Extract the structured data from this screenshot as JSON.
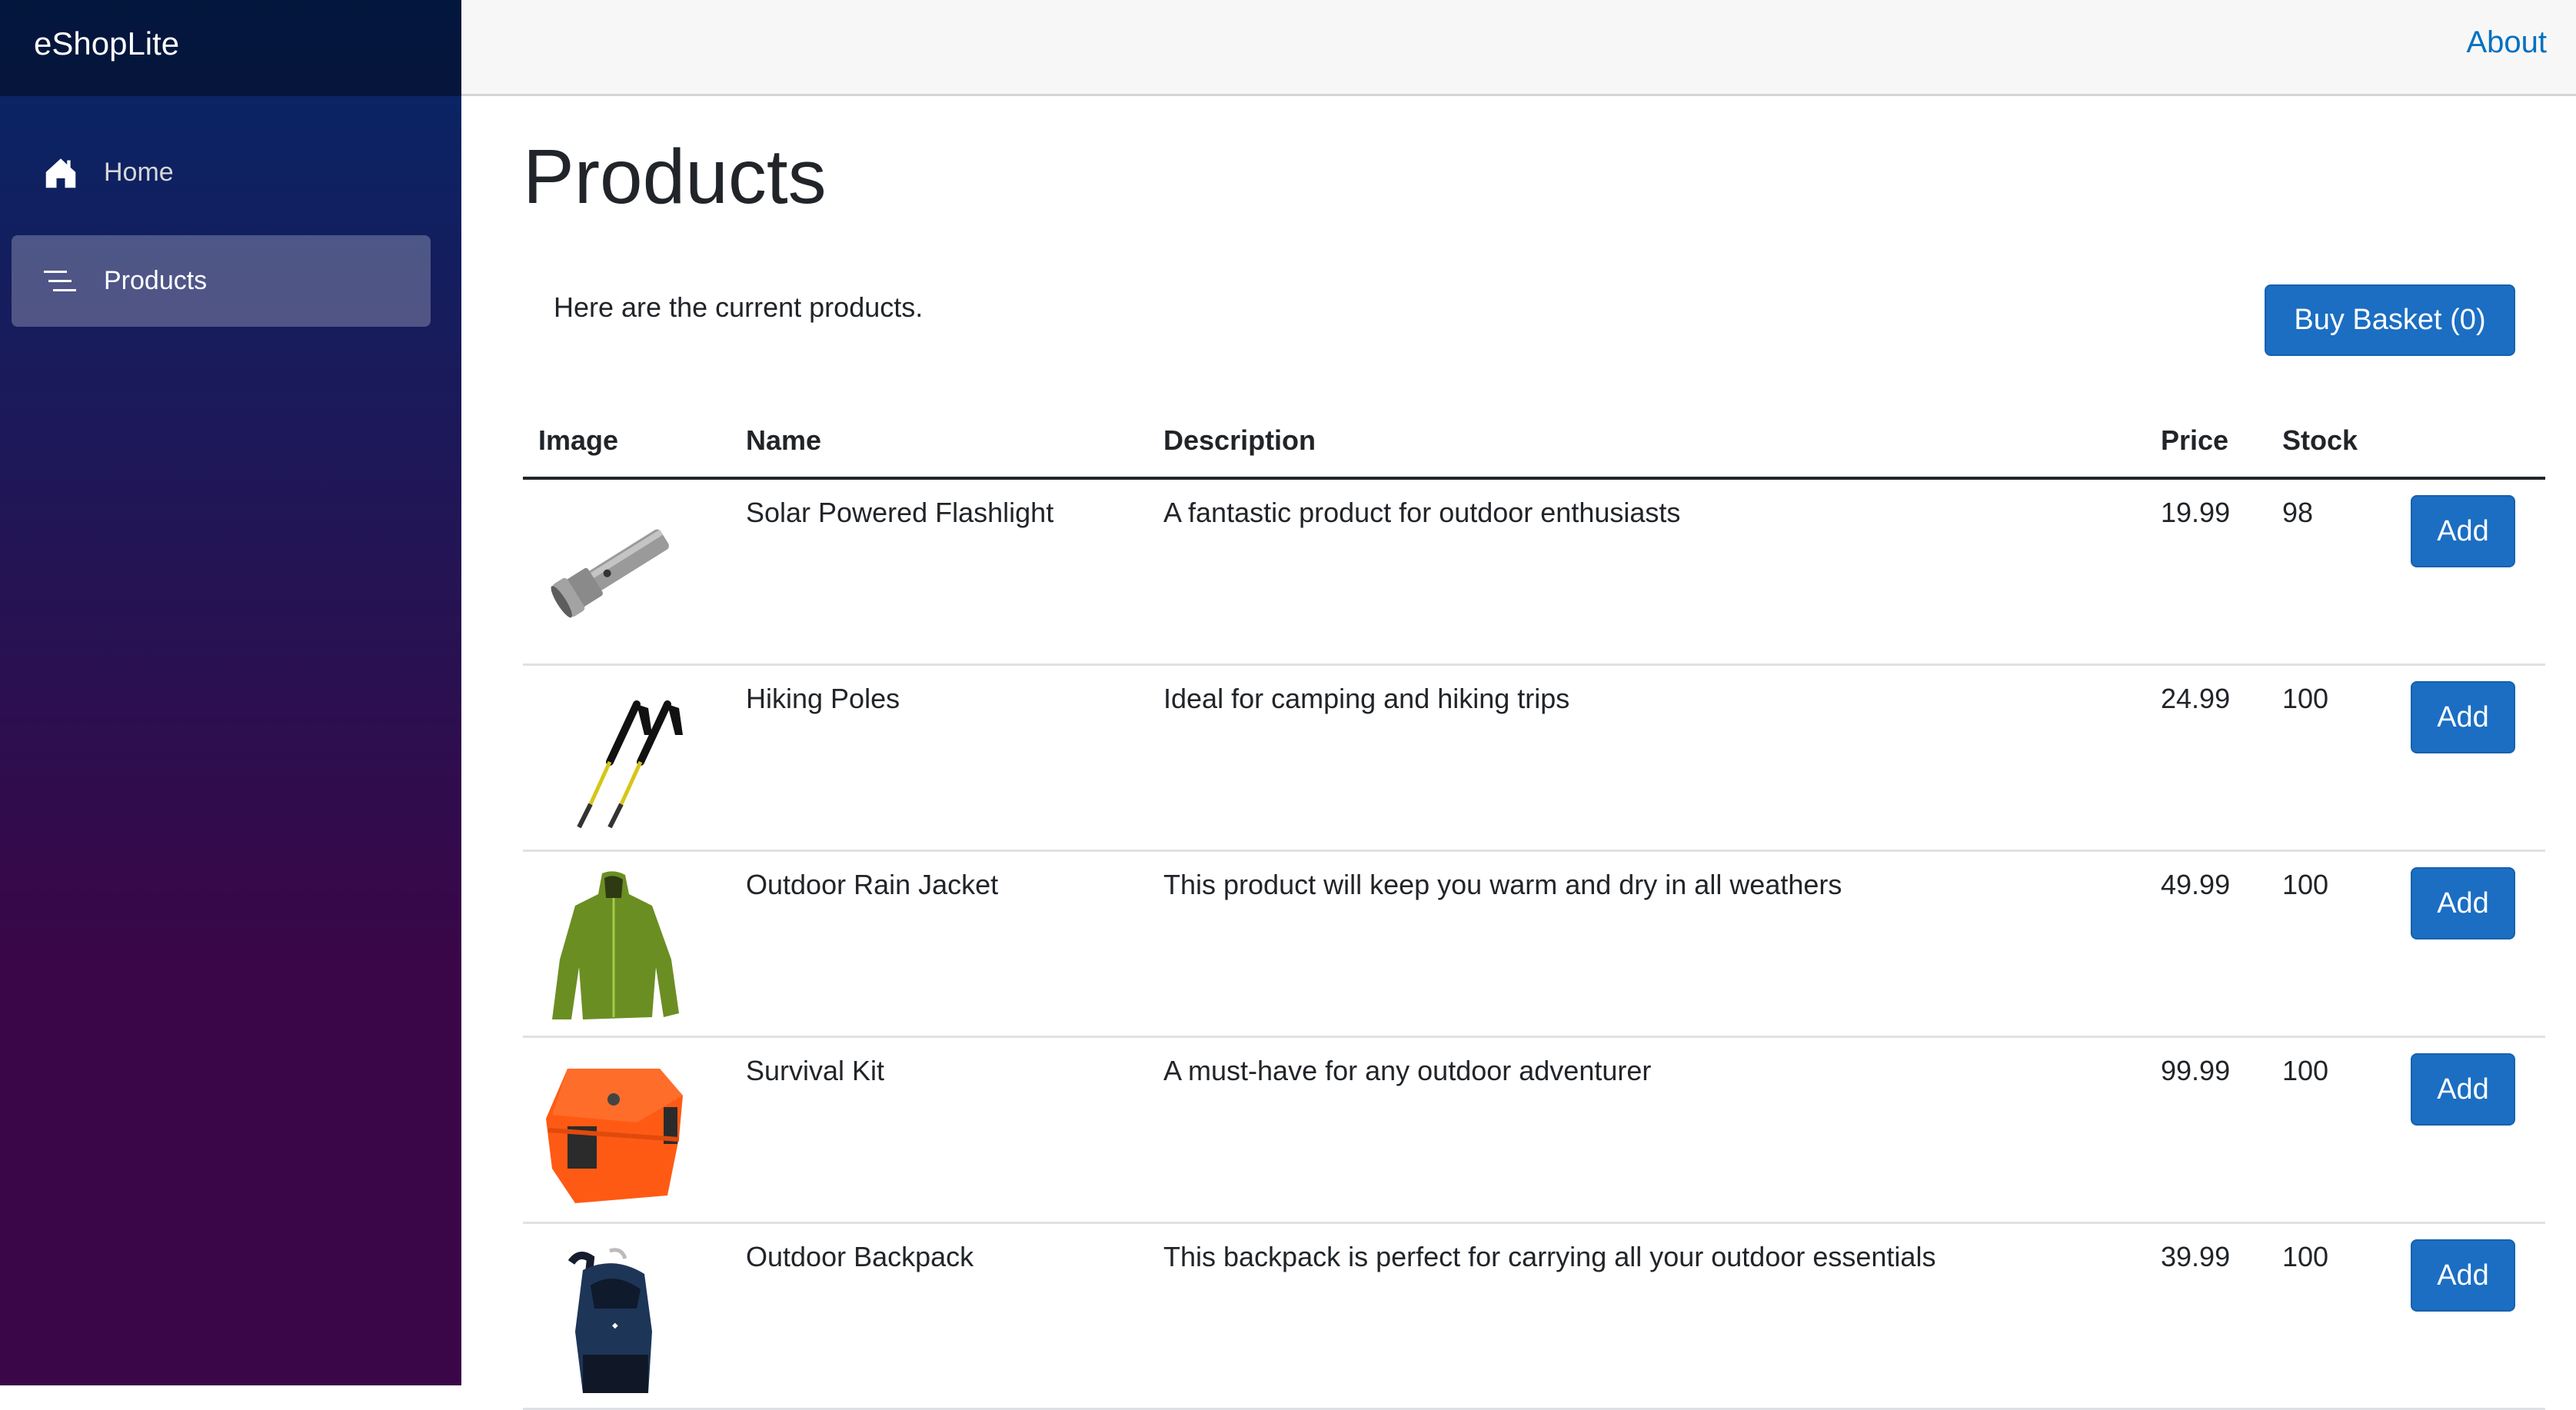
{
  "app": {
    "brand": "eShopLite"
  },
  "sidebar": {
    "items": [
      {
        "label": "Home",
        "icon": "home-icon",
        "active": false
      },
      {
        "label": "Products",
        "icon": "list-icon",
        "active": true
      }
    ]
  },
  "topbar": {
    "about_label": "About"
  },
  "main": {
    "title": "Products",
    "intro": "Here are the current products.",
    "buy_basket_label": "Buy Basket (0)"
  },
  "table": {
    "columns": [
      "Image",
      "Name",
      "Description",
      "Price",
      "Stock"
    ],
    "add_label": "Add",
    "rows": [
      {
        "image": "flashlight",
        "name": "Solar Powered Flashlight",
        "description": "A fantastic product for outdoor enthusiasts",
        "price": "19.99",
        "stock": "98"
      },
      {
        "image": "hiking-poles",
        "name": "Hiking Poles",
        "description": "Ideal for camping and hiking trips",
        "price": "24.99",
        "stock": "100"
      },
      {
        "image": "rain-jacket",
        "name": "Outdoor Rain Jacket",
        "description": "This product will keep you warm and dry in all weathers",
        "price": "49.99",
        "stock": "100"
      },
      {
        "image": "survival-kit",
        "name": "Survival Kit",
        "description": "A must-have for any outdoor adventurer",
        "price": "99.99",
        "stock": "100"
      },
      {
        "image": "backpack",
        "name": "Outdoor Backpack",
        "description": "This backpack is perfect for carrying all your outdoor essentials",
        "price": "39.99",
        "stock": "100"
      }
    ]
  },
  "colors": {
    "primary_button": "#1b6ec2",
    "link": "#0071c1",
    "sidebar_top": "#052767",
    "sidebar_bottom": "#3a0647"
  }
}
